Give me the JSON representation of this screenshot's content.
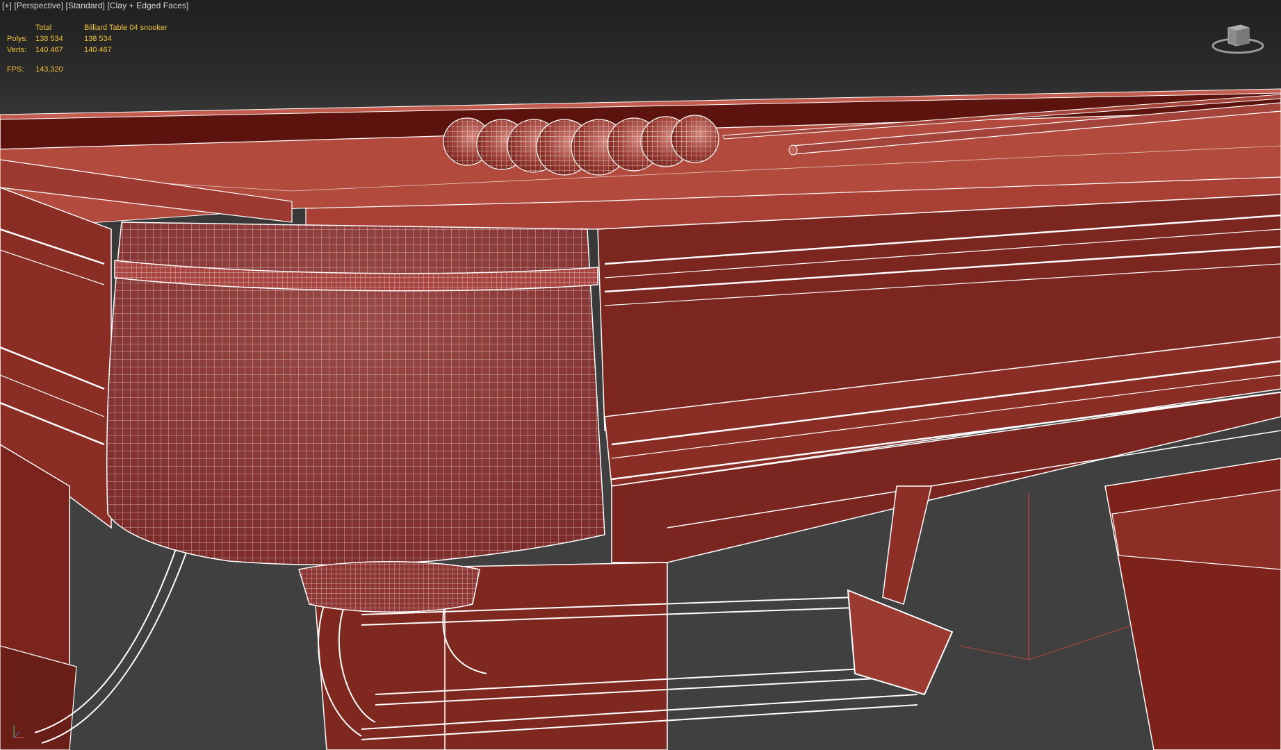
{
  "viewport": {
    "label_parts": [
      "[+]",
      "[Perspective]",
      "[Standard]",
      "[Clay + Edged Faces]"
    ]
  },
  "stats": {
    "header_total": "Total",
    "header_object": "Billiard Table 04 snooker",
    "polys_label": "Polys:",
    "polys_total": "138 534",
    "polys_object": "138 534",
    "verts_label": "Verts:",
    "verts_total": "140 467",
    "verts_object": "140 467",
    "fps_label": "FPS:",
    "fps_value": "143,320"
  },
  "colors": {
    "clay_light": "#b0473c",
    "clay_mid": "#8d2d24",
    "clay_dark": "#6b1a14",
    "wire": "#ffffff",
    "stats_text": "#f2c23c"
  },
  "icons": {
    "viewcube": "viewcube-icon",
    "axis": "axis-tripod-icon"
  }
}
